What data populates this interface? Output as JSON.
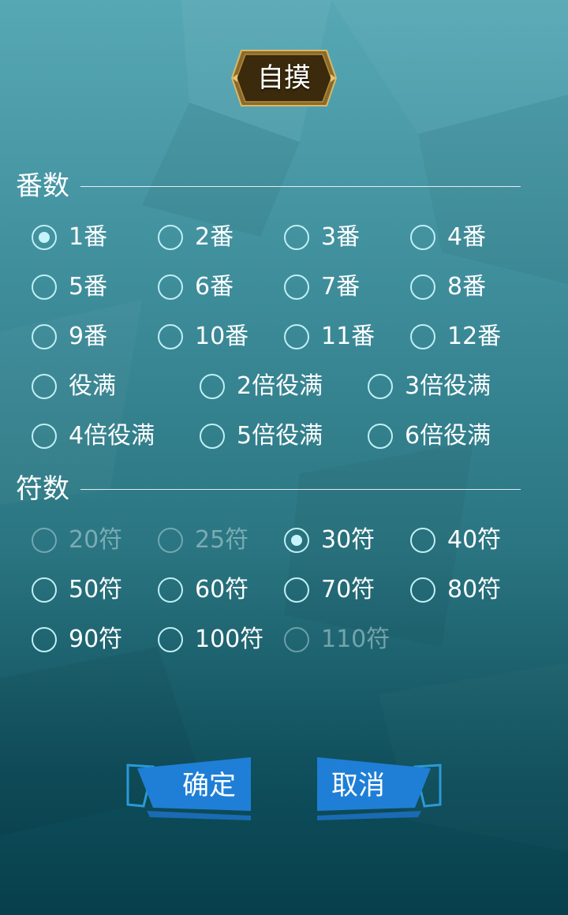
{
  "title": "自摸",
  "fan_section": {
    "title": "番数",
    "options": [
      {
        "label": "1番",
        "checked": true,
        "disabled": false
      },
      {
        "label": "2番",
        "checked": false,
        "disabled": false
      },
      {
        "label": "3番",
        "checked": false,
        "disabled": false
      },
      {
        "label": "4番",
        "checked": false,
        "disabled": false
      },
      {
        "label": "5番",
        "checked": false,
        "disabled": false
      },
      {
        "label": "6番",
        "checked": false,
        "disabled": false
      },
      {
        "label": "7番",
        "checked": false,
        "disabled": false
      },
      {
        "label": "8番",
        "checked": false,
        "disabled": false
      },
      {
        "label": "9番",
        "checked": false,
        "disabled": false
      },
      {
        "label": "10番",
        "checked": false,
        "disabled": false
      },
      {
        "label": "11番",
        "checked": false,
        "disabled": false
      },
      {
        "label": "12番",
        "checked": false,
        "disabled": false
      },
      {
        "label": "役满",
        "checked": false,
        "disabled": false
      },
      {
        "label": "2倍役满",
        "checked": false,
        "disabled": false
      },
      {
        "label": "3倍役满",
        "checked": false,
        "disabled": false
      },
      {
        "label": "4倍役满",
        "checked": false,
        "disabled": false
      },
      {
        "label": "5倍役满",
        "checked": false,
        "disabled": false
      },
      {
        "label": "6倍役满",
        "checked": false,
        "disabled": false
      }
    ]
  },
  "fu_section": {
    "title": "符数",
    "options": [
      {
        "label": "20符",
        "checked": false,
        "disabled": true
      },
      {
        "label": "25符",
        "checked": false,
        "disabled": true
      },
      {
        "label": "30符",
        "checked": true,
        "disabled": false
      },
      {
        "label": "40符",
        "checked": false,
        "disabled": false
      },
      {
        "label": "50符",
        "checked": false,
        "disabled": false
      },
      {
        "label": "60符",
        "checked": false,
        "disabled": false
      },
      {
        "label": "70符",
        "checked": false,
        "disabled": false
      },
      {
        "label": "80符",
        "checked": false,
        "disabled": false
      },
      {
        "label": "90符",
        "checked": false,
        "disabled": false
      },
      {
        "label": "100符",
        "checked": false,
        "disabled": false
      },
      {
        "label": "110符",
        "checked": false,
        "disabled": true
      }
    ]
  },
  "buttons": {
    "confirm": "确定",
    "cancel": "取消"
  },
  "colors": {
    "button_blue": "#1f7fd6",
    "badge_gold": "#c9a24a",
    "badge_dark": "#3a2a0a",
    "radio_border": "#bfeff5"
  }
}
